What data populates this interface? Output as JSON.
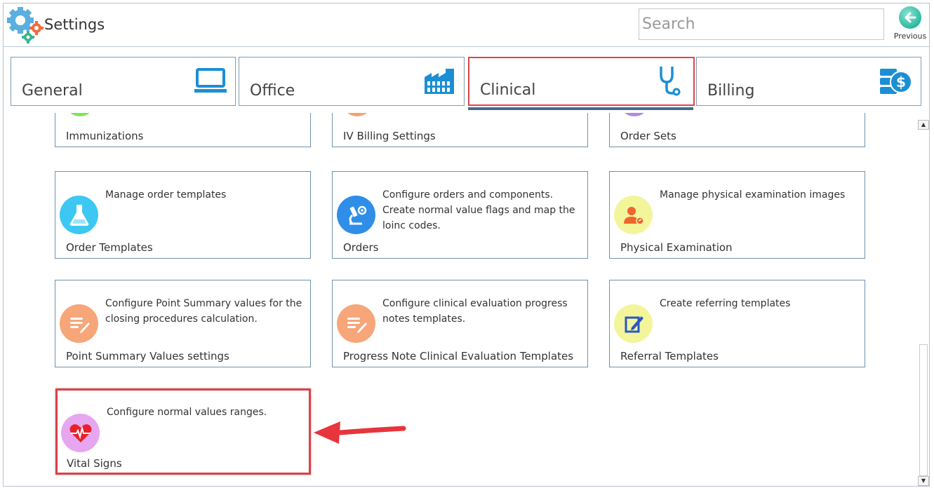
{
  "app": {
    "title": "Settings",
    "logo_icon": "gears-icon"
  },
  "search": {
    "placeholder": "Search",
    "value": ""
  },
  "previous": {
    "label": "Previous",
    "icon": "back-arrow-icon"
  },
  "tabs": [
    {
      "label": "General",
      "icon": "monitor-icon",
      "active": false
    },
    {
      "label": "Office",
      "icon": "factory-icon",
      "active": false
    },
    {
      "label": "Clinical",
      "icon": "stethoscope-icon",
      "active": true
    },
    {
      "label": "Billing",
      "icon": "billing-icon",
      "active": false
    }
  ],
  "cards": {
    "immunizations": {
      "title": "Immunizations"
    },
    "iv_billing": {
      "title": "IV Billing Settings"
    },
    "order_sets": {
      "title": "Order Sets"
    },
    "order_templates": {
      "title": "Order Templates",
      "desc": "Manage order templates",
      "icon": "flask-icon"
    },
    "orders": {
      "title": "Orders",
      "desc": "Configure orders and components. Create normal value flags and map the loinc codes.",
      "icon": "microscope-icon"
    },
    "physical_exam": {
      "title": "Physical Examination",
      "desc": "Manage physical examination images",
      "icon": "person-icon"
    },
    "point_summary": {
      "title": "Point Summary Values settings",
      "desc": "Configure Point Summary values for the closing procedures calculation.",
      "icon": "notes-icon"
    },
    "progress_note": {
      "title": "Progress Note Clinical Evaluation Templates",
      "desc": "Configure clinical evaluation progress notes templates.",
      "icon": "notes-icon"
    },
    "referral": {
      "title": "Referral Templates",
      "desc": "Create referring templates",
      "icon": "edit-icon"
    },
    "vital_signs": {
      "title": "Vital Signs",
      "desc": "Configure normal values ranges.",
      "icon": "heart-icon"
    }
  },
  "colors": {
    "accent_red": "#dc4048",
    "tab_underline": "#466b8c",
    "card_border": "#6f93ac"
  }
}
